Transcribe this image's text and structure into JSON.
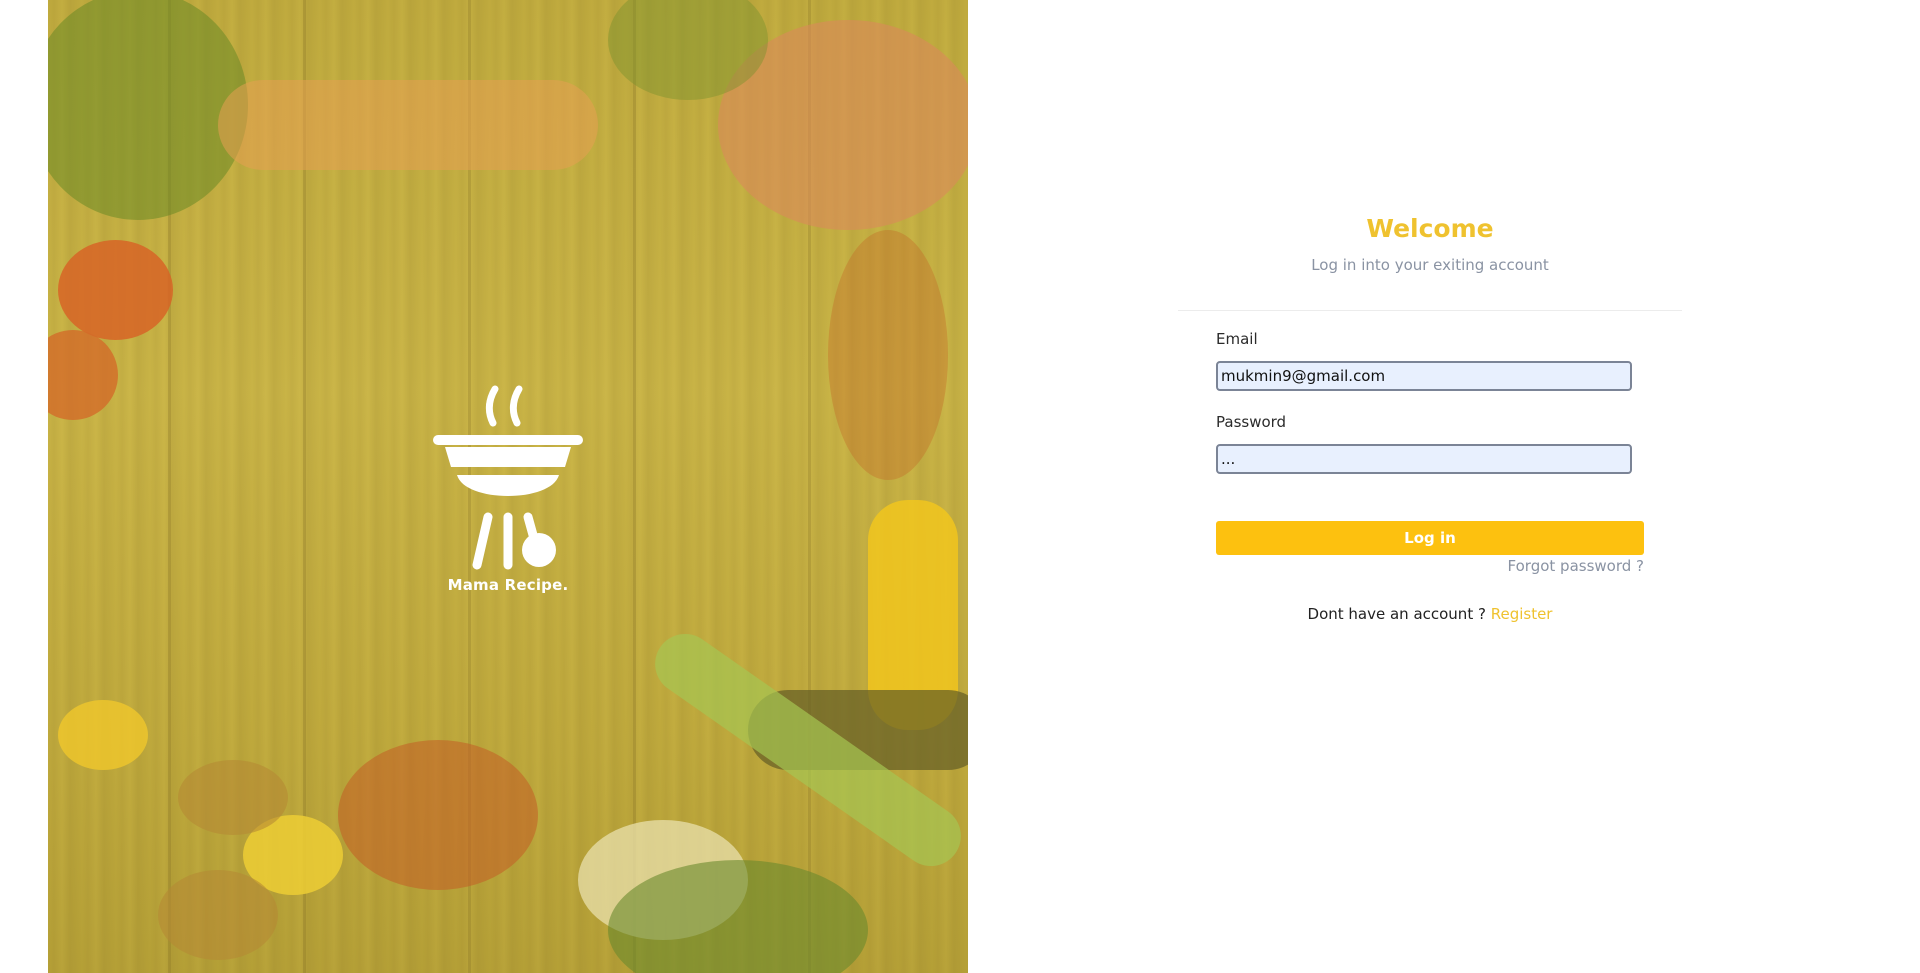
{
  "hero": {
    "logo_text": "Mama Recipe.",
    "icon": "grill-icon",
    "background": "food-on-wooden-table"
  },
  "login": {
    "title": "Welcome",
    "subtitle": "Log in into your exiting account",
    "email": {
      "label": "Email",
      "value": "mukmin9@gmail.com"
    },
    "password": {
      "label": "Password",
      "value": "..."
    },
    "submit_label": "Log in",
    "forgot_label": "Forgot password ?",
    "register_prompt": "Dont have an account ?",
    "register_label": "Register"
  },
  "colors": {
    "accent": "#efc22f",
    "button": "#fdc10f",
    "muted_text": "#8a93a3",
    "input_bg": "#e8f0fe"
  }
}
